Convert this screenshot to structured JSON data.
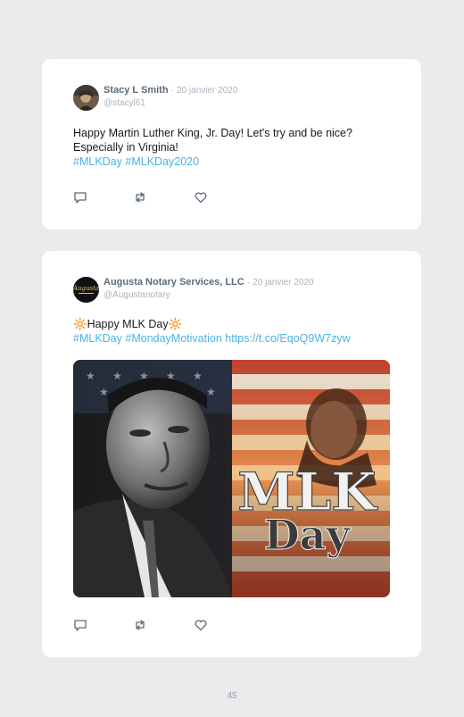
{
  "tweets": [
    {
      "name": "Stacy L Smith",
      "separator": "·",
      "date": "20 janvier 2020",
      "handle": "@stacyl61",
      "text_line1": "Happy Martin Luther King, Jr. Day! Let's try and be nice?",
      "text_line2": "Especially in Virginia!",
      "hashtags": [
        "#MLKDay",
        "#MLKDay2020"
      ],
      "icons": [
        "reply-icon",
        "retweet-icon",
        "like-icon"
      ]
    },
    {
      "name": "Augusta Notary Services, LLC",
      "separator": "·",
      "date": "20 janvier 2020",
      "handle": "@Augustanotary",
      "emoji": "🔆",
      "text_line1": "Happy MLK Day",
      "hashtags": [
        "#MLKDay",
        "#MondayMotivation"
      ],
      "link": "https://t.co/EqoQ9W7zyw",
      "media_text": {
        "line1": "MLK",
        "line2": "Day"
      },
      "avatar_text": "Augusta",
      "icons": [
        "reply-icon",
        "retweet-icon",
        "like-icon"
      ]
    }
  ],
  "page_number": "45",
  "colors": {
    "hashtag": "#4ab3e8",
    "name": "#5a6a7a",
    "muted": "#a8b3be"
  }
}
